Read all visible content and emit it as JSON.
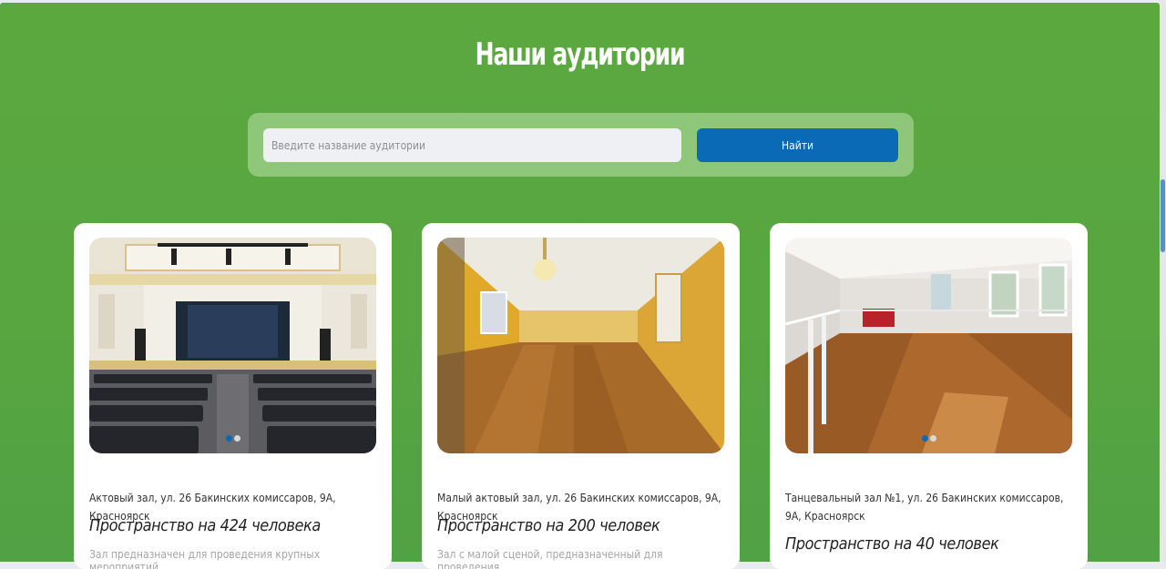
{
  "page": {
    "title": "Наши аудитории"
  },
  "search": {
    "placeholder": "Введите название аудитории",
    "value": "",
    "button_label": "Найти"
  },
  "colors": {
    "background_green": "#5ba83f",
    "search_panel": "#8fc77a",
    "button_blue": "#0b6ab6",
    "card_white": "#ffffff"
  },
  "cards": [
    {
      "image_alt": "assembly-hall-photo",
      "address": "Актовый зал, ул. 26 Бакинских комиссаров, 9А, Красноярск",
      "capacity": "Пространство на 424 человека",
      "description": "Зал предназначен для проведения крупных мероприятий",
      "carousel_slides": 2,
      "carousel_active": 1
    },
    {
      "image_alt": "small-assembly-hall-photo",
      "address": "Малый актовый зал, ул. 26 Бакинских комиссаров, 9А, Красноярск",
      "capacity": "Пространство на 200 человек",
      "description": "Зал с малой сценой, предназначенный для проведения",
      "carousel_slides": 0,
      "carousel_active": 0
    },
    {
      "image_alt": "dance-hall-photo",
      "address": "Танцевальный зал №1, ул. 26 Бакинских комиссаров, 9А, Красноярск",
      "capacity": "Пространство на 40 человек",
      "description": "",
      "carousel_slides": 2,
      "carousel_active": 1
    }
  ]
}
